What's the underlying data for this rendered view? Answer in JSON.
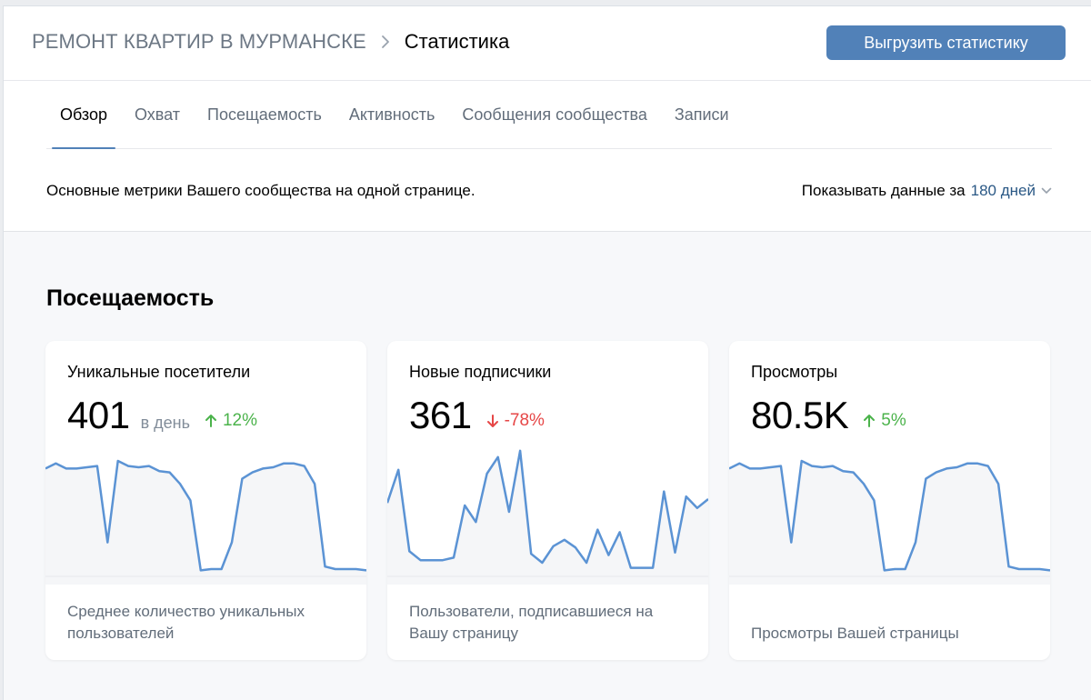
{
  "header": {
    "community": "РЕМОНТ КВАРТИР В МУРМАНСКЕ",
    "page": "Статистика",
    "export_label": "Выгрузить статистику"
  },
  "tabs": [
    {
      "label": "Обзор",
      "active": true
    },
    {
      "label": "Охват",
      "active": false
    },
    {
      "label": "Посещаемость",
      "active": false
    },
    {
      "label": "Активность",
      "active": false
    },
    {
      "label": "Сообщения сообщества",
      "active": false
    },
    {
      "label": "Записи",
      "active": false
    }
  ],
  "subline": {
    "description": "Основные метрики Вашего сообщества на одной странице.",
    "period_prefix": "Показывать данные за",
    "period_value": "180 дней"
  },
  "section_title": "Посещаемость",
  "colors": {
    "accent": "#5181b8",
    "link": "#2a5885",
    "positive": "#4bb34b",
    "negative": "#e64646",
    "line": "#5b93d4",
    "area": "#f5f6f8"
  },
  "icons": {
    "breadcrumb_separator": "chevron-right-icon",
    "period_dropdown": "chevron-down-icon",
    "trend_up": "arrow-up-icon",
    "trend_down": "arrow-down-icon"
  },
  "cards": [
    {
      "title": "Уникальные посетители",
      "value": "401",
      "unit": "в день",
      "change": "12%",
      "direction": "up",
      "description": "Среднее количество уникальных пользователей"
    },
    {
      "title": "Новые подписчики",
      "value": "361",
      "unit": "",
      "change": "-78%",
      "direction": "down",
      "description": "Пользователи, подписавшиеся на Вашу страницу"
    },
    {
      "title": "Просмотры",
      "value": "80.5K",
      "unit": "",
      "change": "5%",
      "direction": "up",
      "description": "Просмотры Вашей страницы"
    }
  ],
  "chart_data": [
    {
      "type": "area",
      "series": [
        {
          "values": [
            84,
            88,
            84,
            84,
            85,
            86,
            26,
            90,
            86,
            85,
            86,
            82,
            81,
            72,
            59,
            4,
            5,
            5,
            26,
            76,
            81,
            84,
            85,
            88,
            88,
            86,
            72,
            7,
            5,
            5,
            5,
            4
          ]
        }
      ],
      "ylim": [
        0,
        100
      ]
    },
    {
      "type": "area",
      "series": [
        {
          "values": [
            57,
            83,
            19,
            12,
            12,
            12,
            14,
            55,
            42,
            80,
            93,
            50,
            98,
            17,
            10,
            23,
            28,
            22,
            10,
            36,
            16,
            34,
            6,
            6,
            6,
            66,
            18,
            62,
            53,
            60
          ]
        }
      ],
      "ylim": [
        0,
        100
      ]
    },
    {
      "type": "area",
      "series": [
        {
          "values": [
            84,
            88,
            84,
            84,
            85,
            86,
            26,
            90,
            86,
            85,
            86,
            82,
            81,
            72,
            59,
            4,
            5,
            5,
            26,
            76,
            81,
            84,
            85,
            88,
            88,
            86,
            72,
            7,
            5,
            5,
            5,
            4
          ]
        }
      ],
      "ylim": [
        0,
        100
      ]
    }
  ]
}
